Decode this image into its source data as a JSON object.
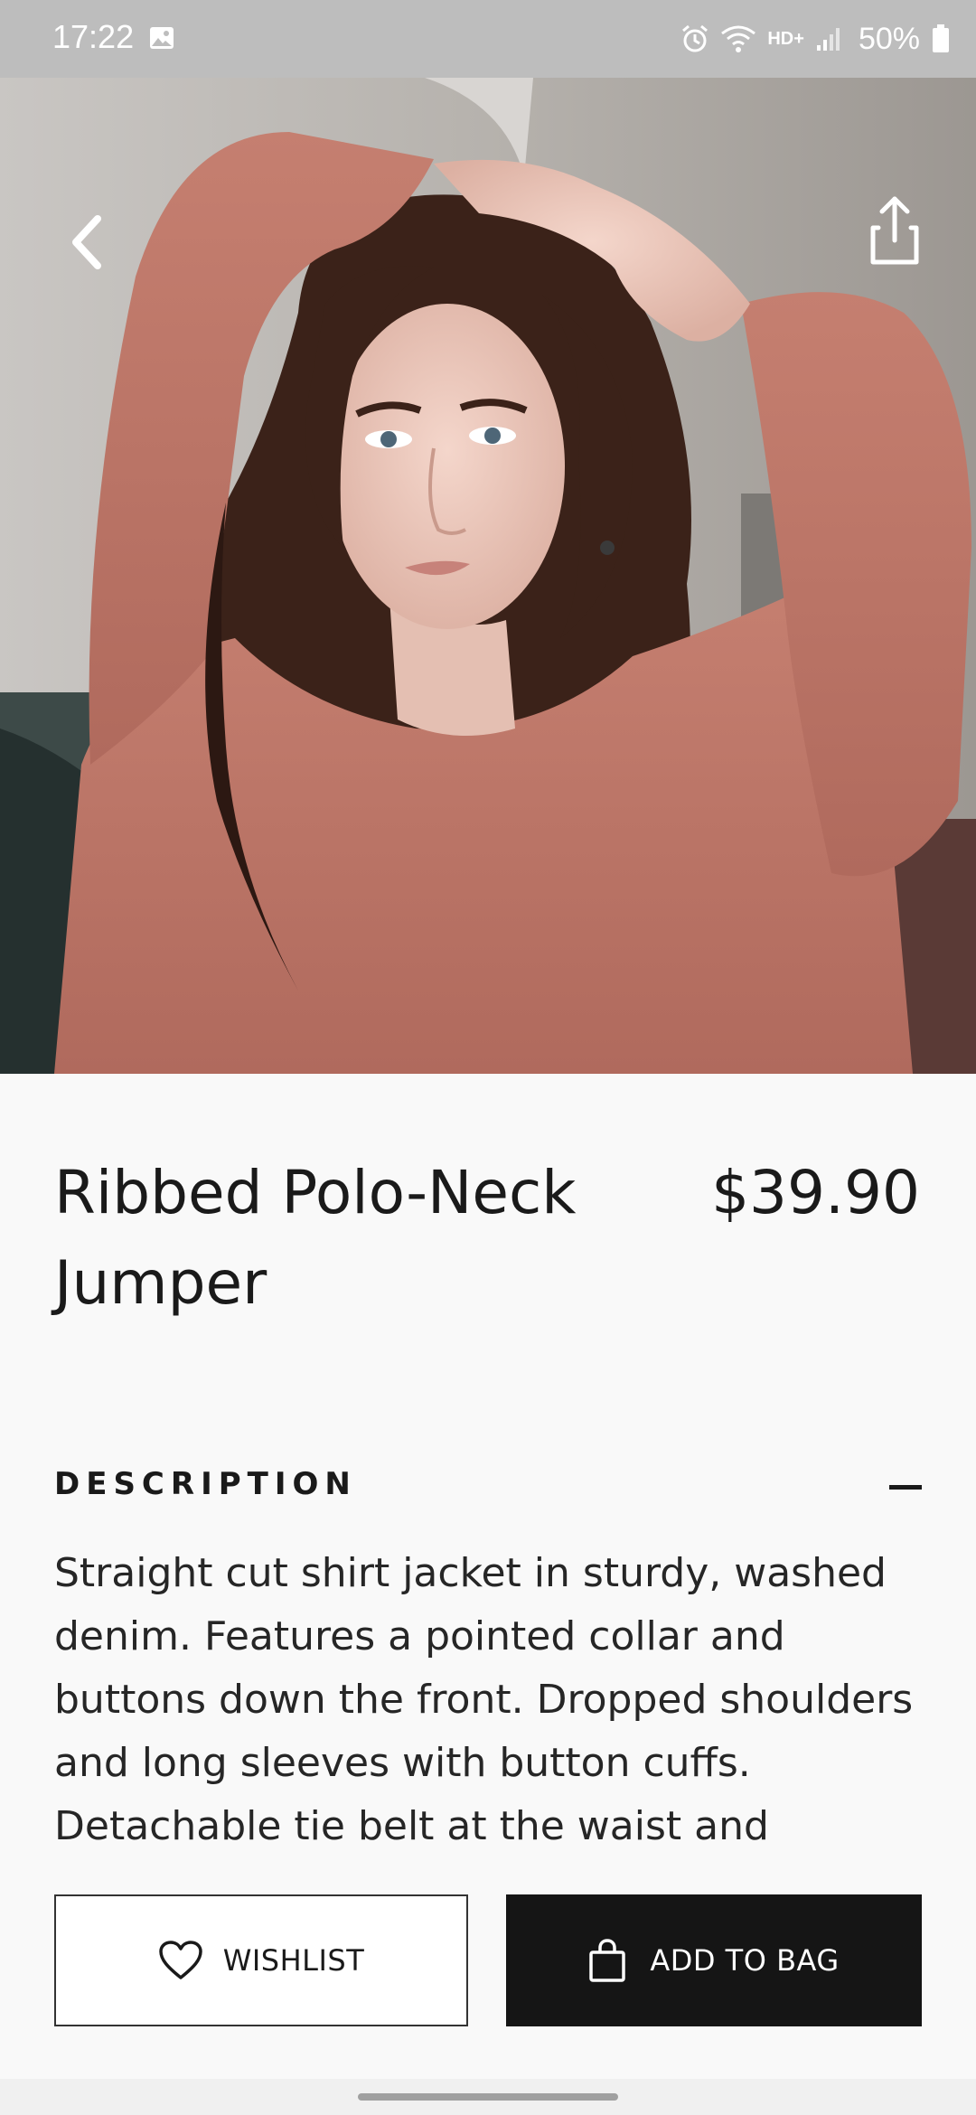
{
  "status_bar": {
    "time": "17:22",
    "network_label": "HD+",
    "battery": "50%",
    "icons": [
      "gallery-icon",
      "alarm-icon",
      "wifi-icon",
      "signal-icon",
      "battery-icon"
    ]
  },
  "hero": {
    "image": "photo-of-woman-in-pink-knit-sweater",
    "back_icon": "chevron-left-icon",
    "share_icon": "share-icon"
  },
  "product": {
    "title": "Ribbed Polo-Neck Jumper",
    "price": "$39.90"
  },
  "description": {
    "header": "DESCRIPTION",
    "toggle_icon": "minus-icon",
    "text": "Straight cut shirt jacket in sturdy, washed denim. Features a pointed collar and buttons down the front. Dropped shoulders and long sleeves with button cuffs. Detachable tie belt at the waist and"
  },
  "actions": {
    "wishlist_label": "WISHLIST",
    "wishlist_icon": "heart-icon",
    "add_to_bag_label": "ADD TO BAG",
    "add_to_bag_icon": "shopping-bag-icon"
  },
  "colors": {
    "background": "#f9f9f9",
    "text": "#1a1a1a",
    "primary_button": "#151515",
    "status_bar": "#bdbdbd"
  }
}
